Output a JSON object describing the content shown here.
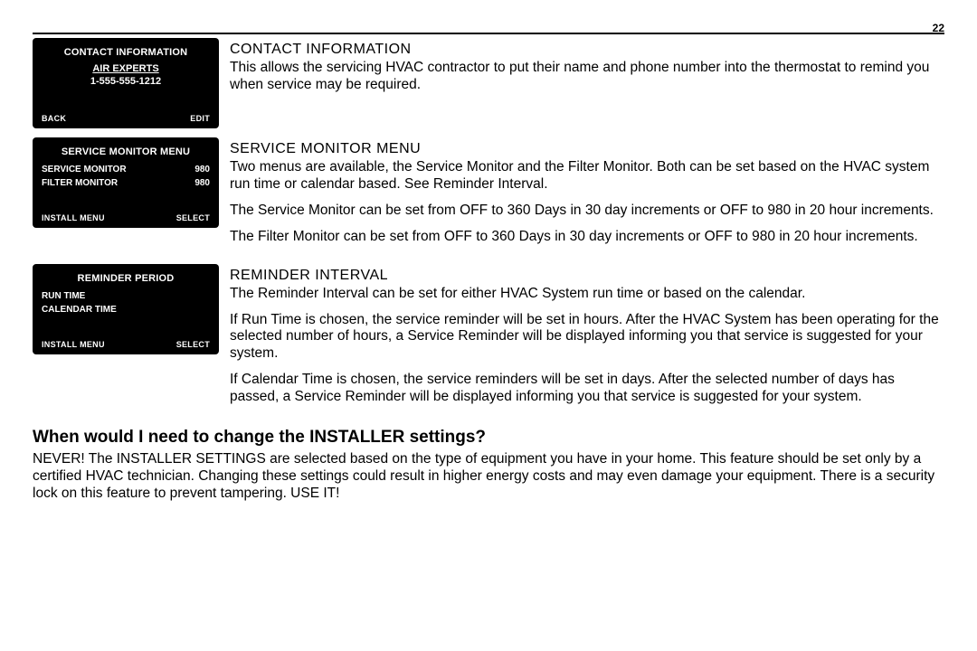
{
  "page_number": "22",
  "lcd_contact": {
    "title": "CONTACT INFORMATION",
    "line1": "AIR EXPERTS",
    "line2": "1-555-555-1212",
    "soft_left": "BACK",
    "soft_right": "EDIT"
  },
  "lcd_service": {
    "title": "SERVICE MONITOR MENU",
    "row1_label": "SERVICE MONITOR",
    "row1_value": "980",
    "row2_label": "FILTER MONITOR",
    "row2_value": "980",
    "soft_left": "INSTALL MENU",
    "soft_right": "SELECT"
  },
  "lcd_reminder": {
    "title": "REMINDER PERIOD",
    "row1": "RUN TIME",
    "row2": "CALENDAR TIME",
    "soft_left": "INSTALL MENU",
    "soft_right": "SELECT"
  },
  "section_contact": {
    "heading": "CONTACT INFORMATION",
    "p1": "This allows the servicing HVAC contractor to put their name and phone number into the thermostat to remind you when service may be required."
  },
  "section_service": {
    "heading": "SERVICE MONITOR MENU",
    "p1": "Two menus are available, the Service Monitor and the Filter Monitor. Both can be set based on the HVAC system run time or calendar based. See Reminder Interval.",
    "p2": "The Service Monitor can be set from OFF to 360 Days in 30 day increments or OFF to 980 in 20 hour increments.",
    "p3": "The Filter Monitor can be set from OFF to 360 Days in 30 day increments or OFF to 980 in 20 hour increments."
  },
  "section_reminder": {
    "heading": "REMINDER INTERVAL",
    "p1": "The Reminder Interval can be set for either HVAC System run time or based on the calendar.",
    "p2": "If Run Time is chosen, the service reminder will be set in hours. After the HVAC System has been operating for the selected number of hours, a Service Reminder will be displayed informing you that service is suggested for your system.",
    "p3": "If Calendar Time is chosen, the service reminders will be set in days. After the selected number of days has passed, a Service Reminder will be displayed informing you that service is suggested for your system."
  },
  "question": {
    "heading": "When would I need to change the INSTALLER settings?",
    "body": "NEVER! The INSTALLER SETTINGS are selected based on the type of equipment you have in your home. This feature should be set only by a certified HVAC technician. Changing these settings could result in higher energy costs and may even damage your equipment. There is a security lock on this feature to prevent tampering. USE IT!"
  }
}
